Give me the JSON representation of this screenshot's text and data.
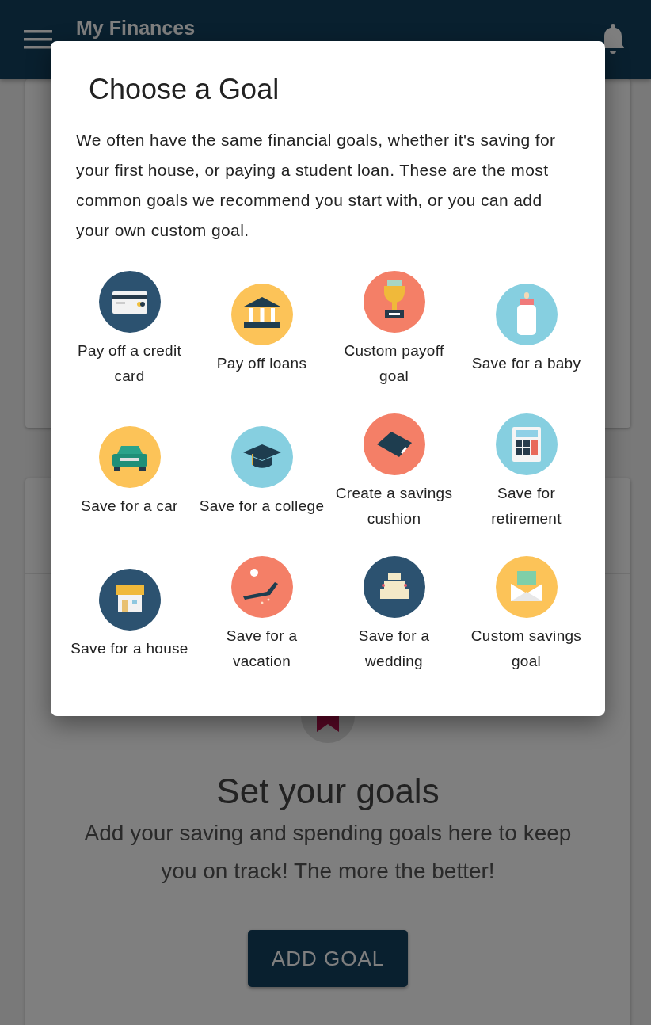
{
  "app_bar": {
    "title": "My Finances"
  },
  "goals_card": {
    "title": "Set your goals",
    "text": "Add your saving and spending goals here to keep you on track! The more the better!",
    "button": "ADD GOAL"
  },
  "dialog": {
    "title": "Choose a Goal",
    "text": "We often have the same financial goals, whether it's saving for your first house, or paying a student loan. These are the most common goals we recommend you start with, or you can add your own custom goal.",
    "goals": [
      {
        "label": "Pay off a credit card",
        "kind": "card",
        "color": "#2c5270"
      },
      {
        "label": "Pay off loans",
        "kind": "bank",
        "color": "#fcc358"
      },
      {
        "label": "Custom payoff goal",
        "kind": "trophy",
        "color": "#f47f67"
      },
      {
        "label": "Save for a baby",
        "kind": "bottle",
        "color": "#86cfe0"
      },
      {
        "label": "Save for a car",
        "kind": "car",
        "color": "#fcc358"
      },
      {
        "label": "Save for a college",
        "kind": "cap",
        "color": "#86cfe0"
      },
      {
        "label": "Create a savings cushion",
        "kind": "pillow",
        "color": "#f47f67"
      },
      {
        "label": "Save for retirement",
        "kind": "calculator",
        "color": "#86cfe0"
      },
      {
        "label": "Save for a house",
        "kind": "house",
        "color": "#2c5270"
      },
      {
        "label": "Save for a vacation",
        "kind": "lounger",
        "color": "#f47f67"
      },
      {
        "label": "Save for a wedding",
        "kind": "cake",
        "color": "#2c5270"
      },
      {
        "label": "Custom savings goal",
        "kind": "envelope",
        "color": "#fcc358"
      }
    ]
  }
}
